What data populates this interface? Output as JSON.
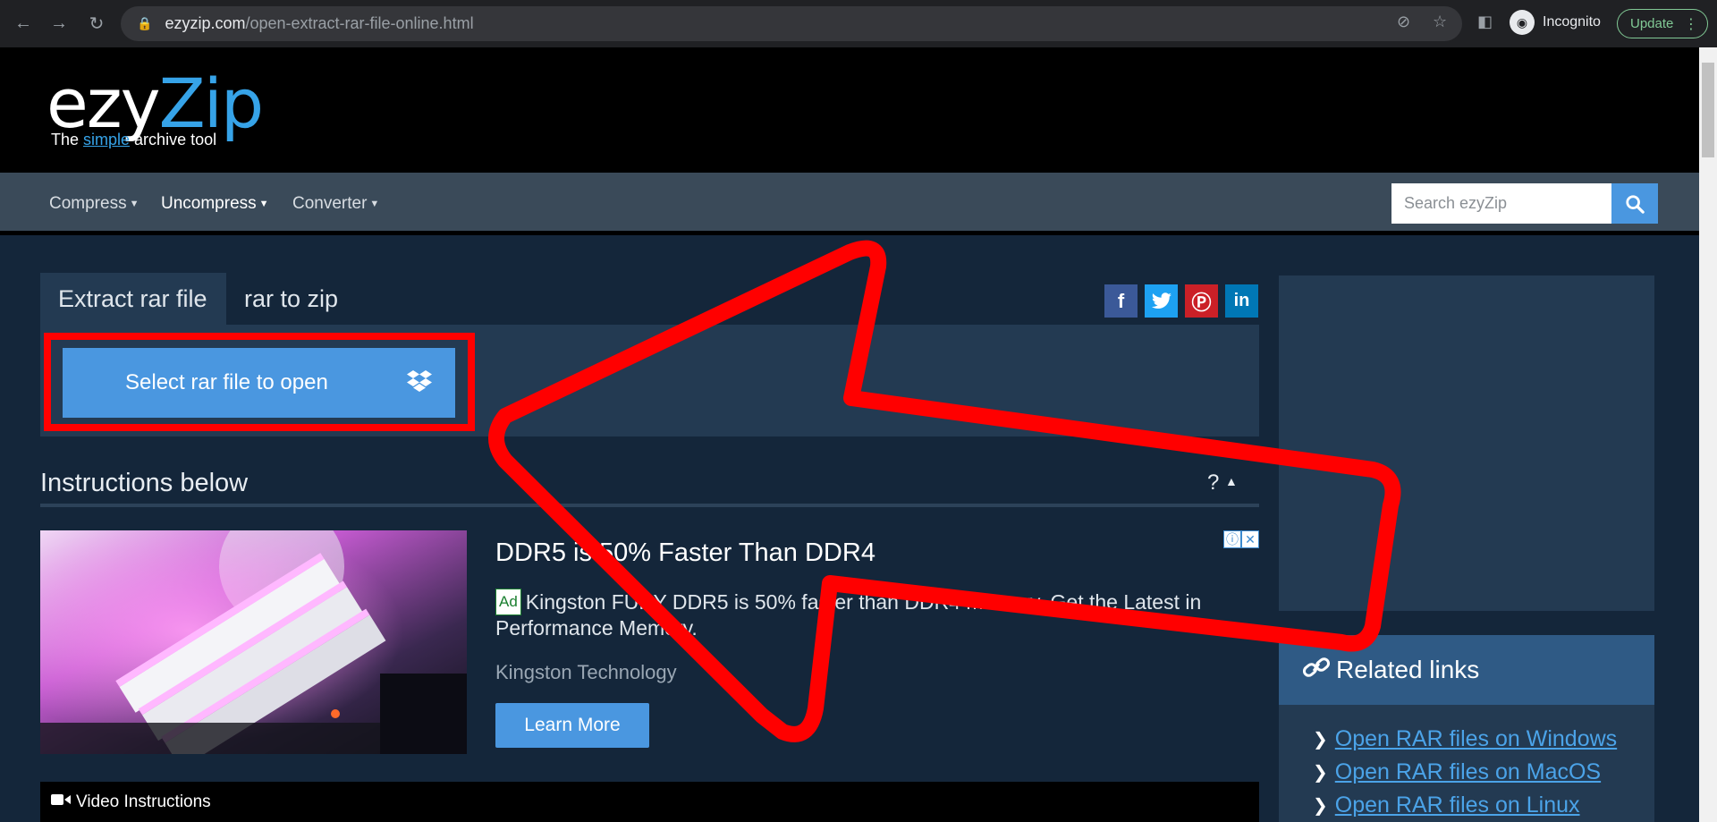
{
  "browser": {
    "url_domain": "ezyzip.com",
    "url_path": "/open-extract-rar-file-online.html",
    "profile_label": "Incognito",
    "update_label": "Update"
  },
  "site": {
    "logo_ezy": "ezy",
    "logo_zip": "Zip",
    "tagline_pre": "The ",
    "tagline_simple": "simple",
    "tagline_post": " archive tool"
  },
  "nav": {
    "items": [
      {
        "label": "Compress"
      },
      {
        "label": "Uncompress"
      },
      {
        "label": "Converter"
      }
    ],
    "search_placeholder": "Search ezyZip"
  },
  "tabs": [
    {
      "label": "Extract rar file"
    },
    {
      "label": "rar to zip"
    }
  ],
  "social": {
    "facebook_color": "#3b5998",
    "twitter_color": "#1da1f2",
    "pinterest_color": "#cb2027",
    "linkedin_color": "#0077b5"
  },
  "upload": {
    "button_label": "Select rar file to open"
  },
  "instructions": {
    "title": "Instructions below",
    "toggle": "?"
  },
  "ad": {
    "title": "DDR5 is 50% Faster Than DDR4",
    "badge": "Ad",
    "body": "Kingston FURY DDR5 is 50% faster than DDR4 memory. Get the Latest in Performance Memory.",
    "source": "Kingston Technology",
    "cta": "Learn More"
  },
  "video": {
    "label": "Video Instructions"
  },
  "related": {
    "title": "Related links",
    "links": [
      {
        "label": "Open RAR files on Windows"
      },
      {
        "label": "Open RAR files on MacOS"
      },
      {
        "label": "Open RAR files on Linux"
      }
    ]
  },
  "colors": {
    "accent": "#4a97e0",
    "logo_blue": "#36a3e8",
    "annotation_red": "#ff0000"
  }
}
